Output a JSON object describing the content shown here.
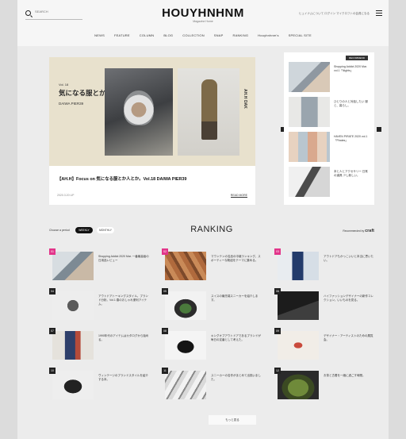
{
  "header": {
    "logo": "HOUYHNHNM",
    "logo_sub": "Magazine Home",
    "search_placeholder": "SEARCH",
    "top_right_text": "ヒュイナムについて  ログイン  マイクロフトの会員になる"
  },
  "nav": [
    "NEWS",
    "FEATURE",
    "COLUMN",
    "BLOG",
    "COLLECTION",
    "SNAP",
    "RANKING",
    "Houyhnhnm's",
    "SPECIAL SITE"
  ],
  "hero": {
    "vol_label": "Vol. 18",
    "catch": "気になる服とか人とか。",
    "brand": "DAIWA PIER39",
    "vertical_text": "AH.H OAK",
    "title": "【AH.H】Focus on 気になる服とか人とか。Vol.18 DAIWA PIER39",
    "date": "2020.3.20 UP",
    "more": "READ MORE"
  },
  "side": {
    "badge": "RECOMMEND",
    "items": [
      {
        "text": "Shopping Addict 2020 Mar. vol.1「Nights」"
      },
      {
        "text": "ひとりの人と対話したい 服と、暮らし。"
      },
      {
        "text": "HAVEN PIRATE 2020 vol.1「Pirates」"
      },
      {
        "text": "本と人とアクセサリー 日常の道具 少し新しい。"
      }
    ]
  },
  "ranking": {
    "choose_label": "Choose a period",
    "period_active": "WEEKLY",
    "period_other": "MONTHLY",
    "title": "RANKING",
    "presented_label": "Recommended by",
    "presented_brand": "craft",
    "more": "もっと見る",
    "items": [
      {
        "rank": "01",
        "text": "Shopping Addict 2020 Mar. 一番最高級の日用品レビュー"
      },
      {
        "rank": "02",
        "text": "マウンテンの名品の中継ランキング。スポーティーな靴紐をテーマに集める。"
      },
      {
        "rank": "03",
        "text": "アウトドアもかっこいいと本当に思いたい。"
      },
      {
        "rank": "04",
        "text": "アウトドアトーキングスタイル。ブランド分析。Vol.1 春のおしゃれ便利アイテム。"
      },
      {
        "rank": "05",
        "text": "スイスの最先端スニーカーを紹介します。"
      },
      {
        "rank": "06",
        "text": "ハイファッションデザイナーの新作コレクション。いいものを見る。"
      },
      {
        "rank": "07",
        "text": "1990年代のアイテムはカタログから始める。"
      },
      {
        "rank": "08",
        "text": "キングオブアウトドアであるブランドが毎日の定番として考えた。"
      },
      {
        "rank": "09",
        "text": "デザイナー・アーティストのための展覧会。"
      },
      {
        "rank": "10",
        "text": "ヴィンテージのブランドスタイルを紹介する本。"
      },
      {
        "rank": "11",
        "text": "スニーカーの名作がまとめて出揃いました。"
      },
      {
        "rank": "12",
        "text": "お茶と古着を一緒に過ごす時間。"
      }
    ]
  },
  "colors": {
    "page_bg": "#ececec",
    "rank_accent": "#e2358a",
    "pill_active": "#111111"
  }
}
